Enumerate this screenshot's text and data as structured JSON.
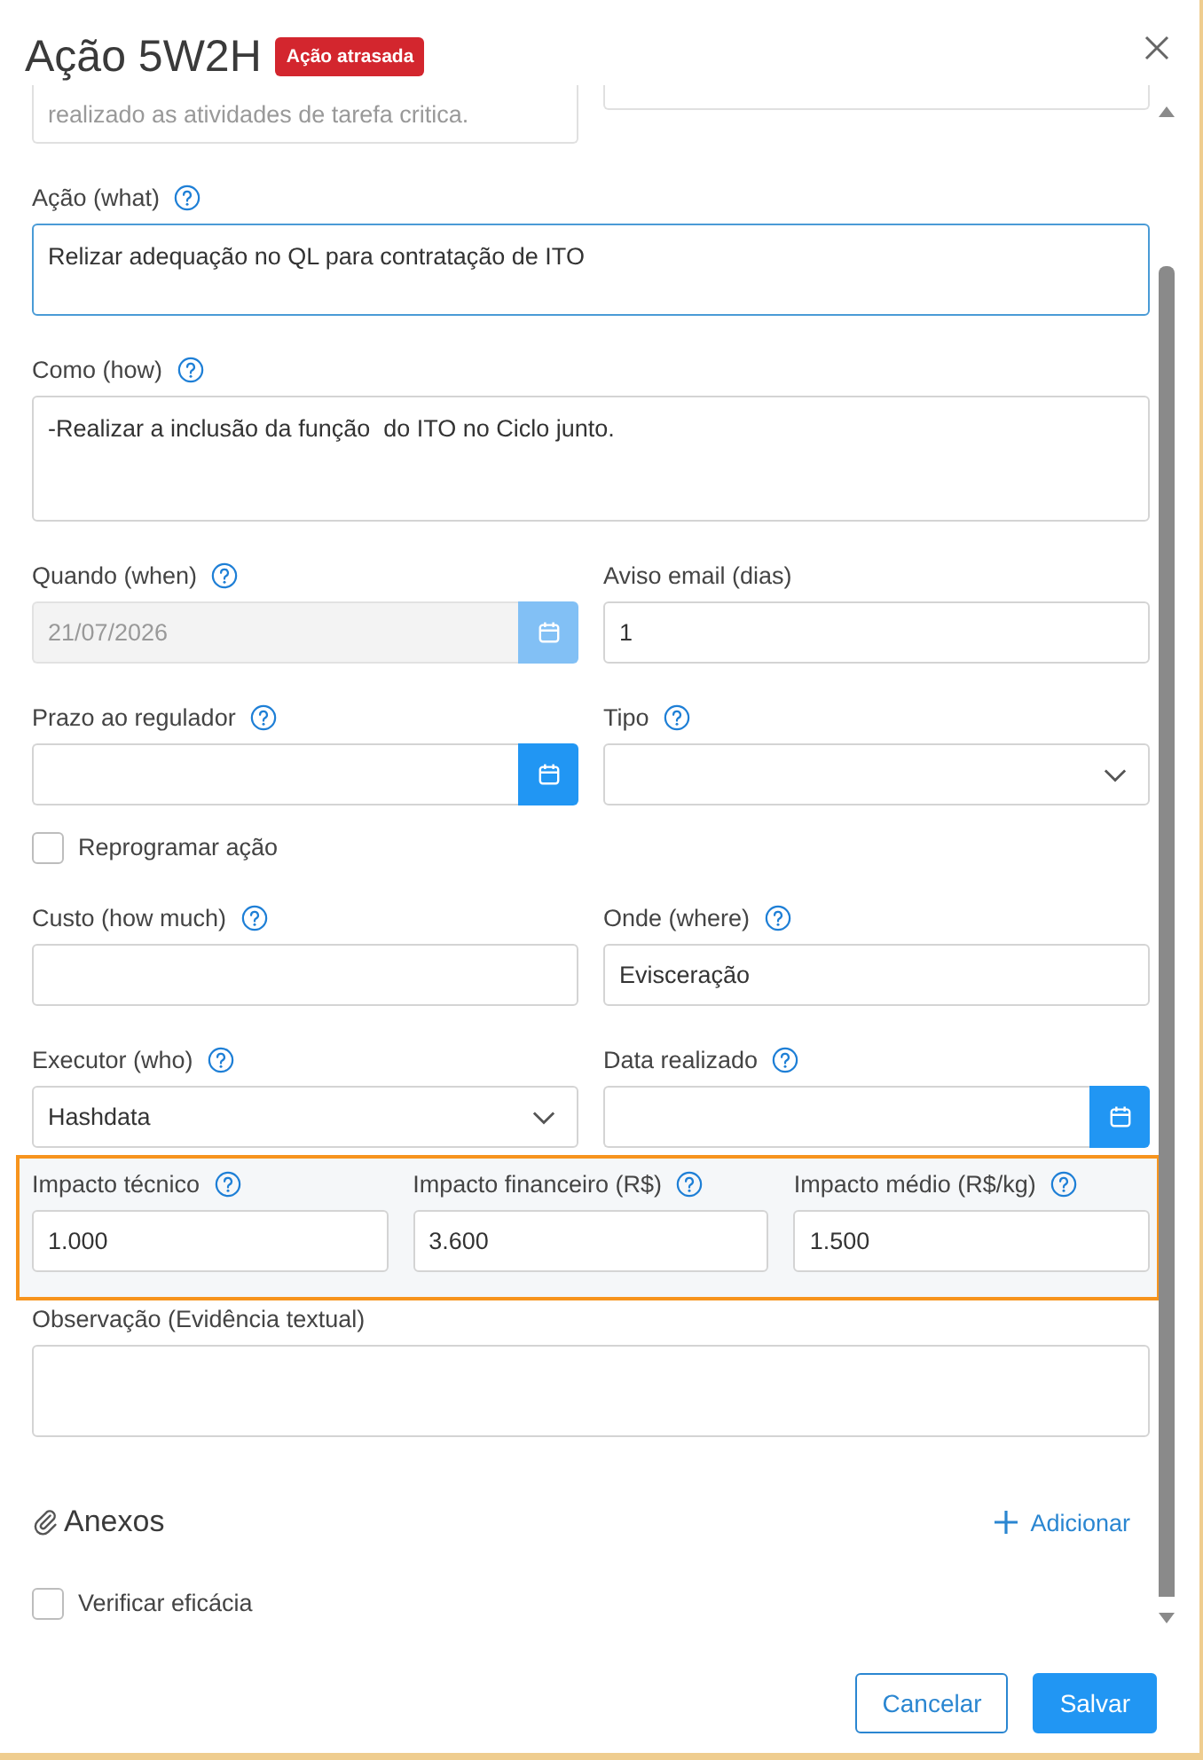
{
  "dialog": {
    "title": "Ação 5W2H",
    "badge": "Ação atrasada"
  },
  "form": {
    "rows": [
      {
        "kind": "clipped",
        "fields": [
          {
            "kind": "textarea",
            "value": "realizado as atividades de tarefa critica.",
            "disabled": true,
            "focused": false
          },
          {
            "kind": "text",
            "disabled": false,
            "focused": false
          }
        ]
      },
      {
        "kind": "fields",
        "highlighted": false,
        "fields": [
          {
            "kind": "textarea",
            "label": "Ação (what)",
            "help": true,
            "value": "Relizar adequação no QL para contratação de ITO",
            "disabled": false,
            "focused": true
          }
        ]
      },
      {
        "kind": "fields",
        "highlighted": false,
        "fields": [
          {
            "kind": "longtext",
            "label": "Como (how)",
            "help": true,
            "value": "-Realizar a inclusão da função  do ITO no Ciclo junto.",
            "disabled": false,
            "focused": false
          }
        ]
      },
      {
        "kind": "fields",
        "highlighted": false,
        "fields": [
          {
            "kind": "date",
            "label": "Quando (when)",
            "help": true,
            "value": "21/07/2026",
            "disabled": true,
            "focused": false
          },
          {
            "kind": "text",
            "label": "Aviso email (dias)",
            "help": false,
            "value": "1",
            "disabled": false,
            "focused": false
          }
        ]
      },
      {
        "kind": "fields",
        "highlighted": false,
        "fields": [
          {
            "kind": "date",
            "label": "Prazo ao regulador",
            "help": true,
            "disabled": false,
            "focused": false
          },
          {
            "kind": "select",
            "label": "Tipo",
            "help": true,
            "disabled": false,
            "focused": false
          }
        ]
      },
      {
        "kind": "checkbox",
        "label": "Reprogramar ação",
        "checked": false
      },
      {
        "kind": "fields",
        "highlighted": false,
        "fields": [
          {
            "kind": "text",
            "label": "Custo (how much)",
            "help": true,
            "disabled": false,
            "focused": false
          },
          {
            "kind": "text",
            "label": "Onde (where)",
            "help": true,
            "value": "Evisceração",
            "disabled": false,
            "focused": false
          }
        ]
      },
      {
        "kind": "fields",
        "highlighted": false,
        "fields": [
          {
            "kind": "select",
            "label": "Executor (who)",
            "help": true,
            "value": "Hashdata",
            "disabled": false,
            "focused": false
          },
          {
            "kind": "date",
            "label": "Data realizado",
            "help": true,
            "disabled": false,
            "focused": false
          }
        ]
      },
      {
        "kind": "fields",
        "highlighted": true,
        "fields": [
          {
            "kind": "text",
            "label": "Impacto técnico",
            "help": true,
            "value": "1.000",
            "disabled": false,
            "focused": false
          },
          {
            "kind": "text",
            "label": "Impacto financeiro (R$)",
            "help": true,
            "value": "3.600",
            "disabled": false,
            "focused": false
          },
          {
            "kind": "text",
            "label": "Impacto médio (R$/kg)",
            "help": true,
            "value": "1.500",
            "disabled": false,
            "focused": false
          }
        ]
      },
      {
        "kind": "fields",
        "highlighted": false,
        "fields": [
          {
            "kind": "textarea",
            "label": "Observação (Evidência textual)",
            "help": false,
            "disabled": false,
            "focused": false
          }
        ]
      },
      {
        "kind": "attachments",
        "title": "Anexos",
        "action": "Adicionar"
      },
      {
        "kind": "checkbox",
        "label": "Verificar eficácia",
        "checked": false
      }
    ]
  },
  "buttons": [
    {
      "label": "Cancelar",
      "kind": "secondary"
    },
    {
      "label": "Salvar",
      "kind": "primary"
    }
  ]
}
